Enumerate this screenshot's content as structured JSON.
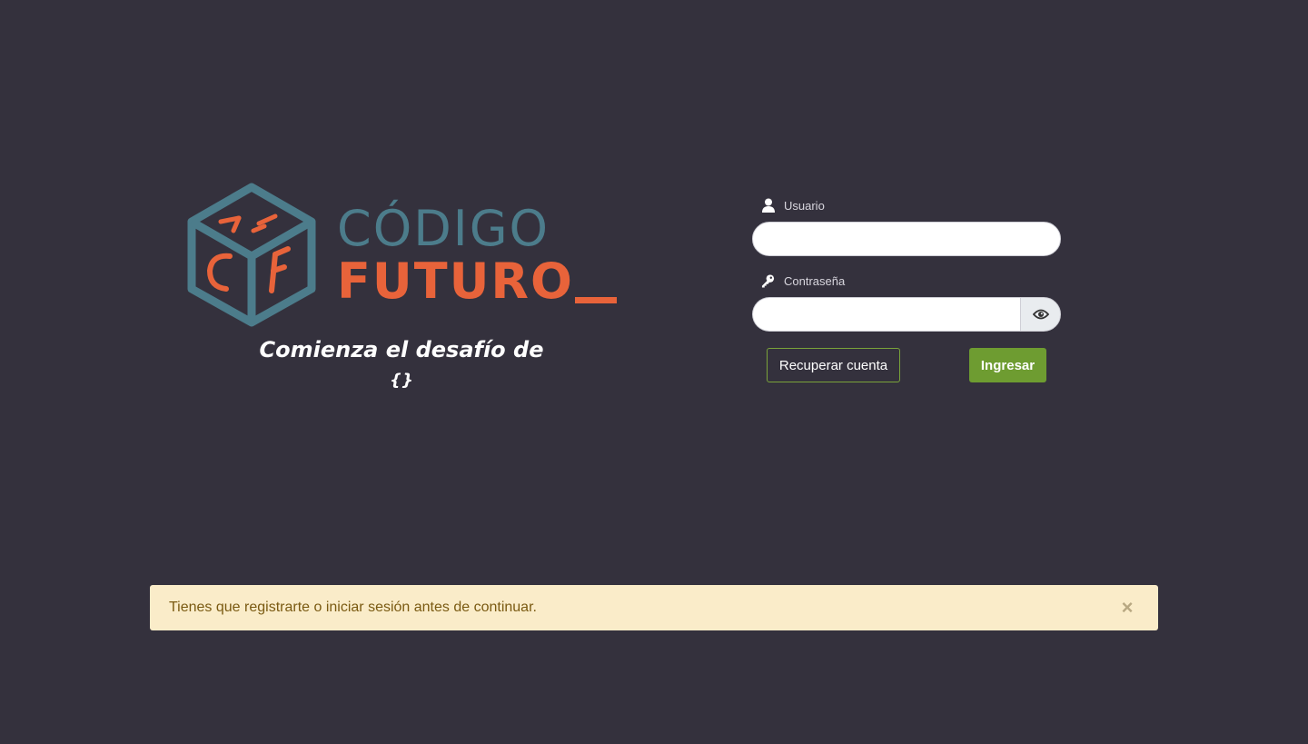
{
  "brand": {
    "logo_top": "CÓDIGO",
    "logo_bottom": "FUTURO",
    "colors": {
      "teal": "#4c7c8b",
      "orange": "#e8633a"
    }
  },
  "tagline": {
    "line1": "Comienza el desafío de",
    "line2": "{}"
  },
  "login_form": {
    "username_label": "Usuario",
    "username_icon": "user-icon",
    "username_value": "",
    "password_label": "Contraseña",
    "password_icon": "key-icon",
    "password_value": "",
    "toggle_password_icon": "eye-icon",
    "recover_button": "Recuperar cuenta",
    "submit_button": "Ingresar",
    "accent_color": "#6e9c31"
  },
  "alert": {
    "message": "Tienes que registrarte o iniciar sesión antes de continuar.",
    "close_icon": "close-icon",
    "close_glyph": "×",
    "background": "#faecc9"
  },
  "theme": {
    "background": "#34313d"
  }
}
